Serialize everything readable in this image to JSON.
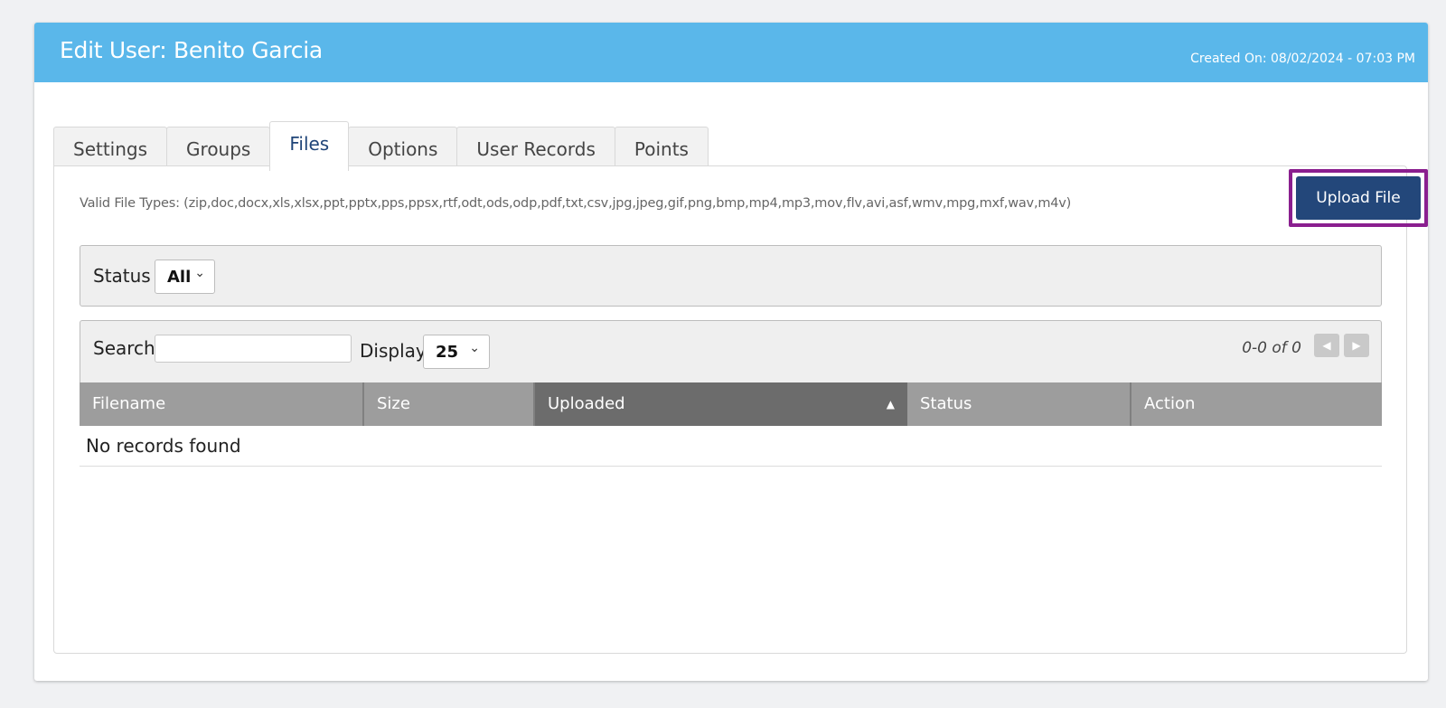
{
  "header": {
    "title": "Edit User: Benito Garcia",
    "created_on": "Created On: 08/02/2024 - 07:03 PM",
    "color": "#5ab7ea"
  },
  "tabs": [
    {
      "label": "Settings",
      "active": false
    },
    {
      "label": "Groups",
      "active": false
    },
    {
      "label": "Files",
      "active": true
    },
    {
      "label": "Options",
      "active": false
    },
    {
      "label": "User Records",
      "active": false
    },
    {
      "label": "Points",
      "active": false
    }
  ],
  "files": {
    "valid_types": "Valid File Types: (zip,doc,docx,xls,xlsx,ppt,pptx,pps,ppsx,rtf,odt,ods,odp,pdf,txt,csv,jpg,jpeg,gif,png,bmp,mp4,mp3,mov,flv,avi,asf,wmv,mpg,mxf,wav,m4v)",
    "upload_label": "Upload File",
    "upload_color": "#23477a",
    "highlight_color": "#8a1f8f"
  },
  "filter": {
    "status_label": "Status",
    "status_value": "All"
  },
  "table": {
    "search_label": "Search",
    "search_value": "",
    "display_label": "Display",
    "display_value": "25",
    "pager_text": "0-0 of 0",
    "prev_icon": "triangle-left-icon",
    "next_icon": "triangle-right-icon",
    "columns": [
      "Filename",
      "Size",
      "Uploaded",
      "Status",
      "Action"
    ],
    "sorted_column": "Uploaded",
    "sort_direction": "ascending",
    "empty_text": "No records found"
  }
}
